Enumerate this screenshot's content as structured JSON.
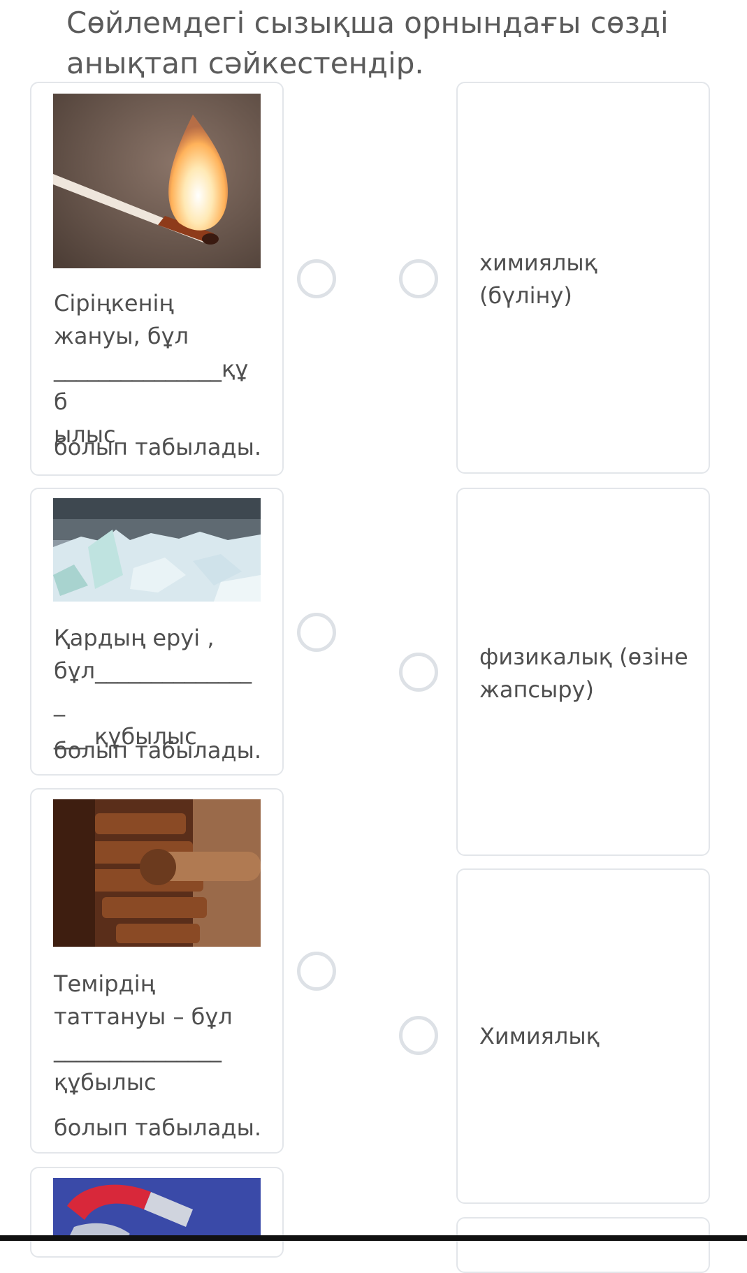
{
  "question": {
    "title": "Сөйлемдегі сызықша орнындағы сөзді анықтап сәйкестендір."
  },
  "left_items": [
    {
      "image": "burning-match-photo",
      "text": "Сіріңкенің\nжануы, бұл\n_______________құб\nылыс",
      "tail": "болып табылады."
    },
    {
      "image": "melting-ice-photo",
      "text": "Қардың еруі ,\nбұл_______________\n___ құбылыс",
      "tail": "болып табылады."
    },
    {
      "image": "rusty-gears-photo",
      "text": "Темірдің\nтаттануы – бұл\n_______________\nқұбылыс",
      "tail": "болып табылады."
    },
    {
      "image": "magnet-photo"
    }
  ],
  "right_items": [
    {
      "text": "химиялық (бүліну)"
    },
    {
      "text": "физикалық (өзіне жапсыру)"
    },
    {
      "text": "Химиялық"
    }
  ]
}
